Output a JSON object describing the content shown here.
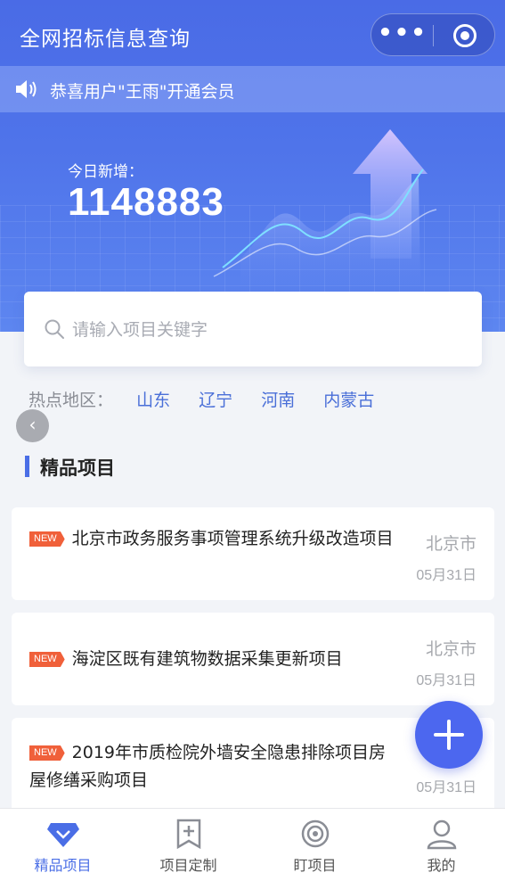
{
  "app": {
    "title": "全网招标信息查询"
  },
  "capsule": {
    "more_label": "•••"
  },
  "notice": {
    "text": "恭喜用户\"王雨\"开通会员"
  },
  "stats": {
    "today_label": "今日新增：",
    "today_value": "1148883"
  },
  "search": {
    "placeholder": "请输入项目关键字"
  },
  "hot_regions": {
    "label": "热点地区：",
    "items": [
      "山东",
      "辽宁",
      "河南",
      "内蒙古"
    ]
  },
  "section": {
    "title": "精品项目"
  },
  "projects": [
    {
      "badge": "NEW",
      "title": "北京市政务服务事项管理系统升级改造项目",
      "city": "北京市",
      "date": "05月31日"
    },
    {
      "badge": "NEW",
      "title": "海淀区既有建筑物数据采集更新项目",
      "city": "北京市",
      "date": "05月31日"
    },
    {
      "badge": "NEW",
      "title": "2019年市质检院外墙安全隐患排除项目房屋修缮采购项目",
      "city": "",
      "date": "05月31日"
    }
  ],
  "tabbar": {
    "items": [
      {
        "label": "精品项目",
        "icon": "diamond-icon",
        "active": true
      },
      {
        "label": "项目定制",
        "icon": "bookmark-plus-icon",
        "active": false
      },
      {
        "label": "盯项目",
        "icon": "target-icon",
        "active": false
      },
      {
        "label": "我的",
        "icon": "user-icon",
        "active": false
      }
    ]
  },
  "colors": {
    "primary": "#4a6ee6",
    "badge": "#f0603a",
    "fab": "#4c67ef"
  }
}
